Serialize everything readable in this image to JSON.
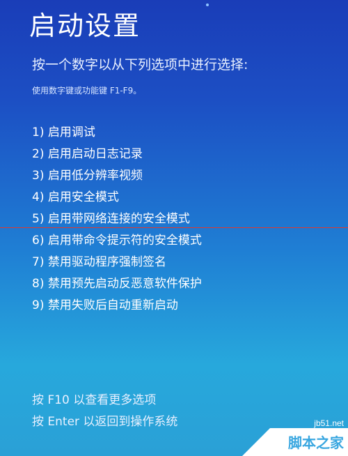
{
  "title": "启动设置",
  "subtitle": "按一个数字以从下列选项中进行选择:",
  "hint": "使用数字键或功能键 F1-F9。",
  "options": [
    "1) 启用调试",
    "2) 启用启动日志记录",
    "3) 启用低分辨率视频",
    "4) 启用安全模式",
    "5) 启用带网络连接的安全模式",
    "6) 启用带命令提示符的安全模式",
    "7) 禁用驱动程序强制签名",
    "8) 禁用预先启动反恶意软件保护",
    "9) 禁用失败后自动重新启动"
  ],
  "footer": {
    "more_options": "按 F10 以查看更多选项",
    "return_os": "按 Enter 以返回到操作系统"
  },
  "watermark": {
    "url": "jb51.net",
    "name": "脚本之家"
  },
  "colors": {
    "background_top": "#1a3db8",
    "background_bottom": "#2aa0d6",
    "text": "#ffffff",
    "red_line": "#e0382e"
  }
}
